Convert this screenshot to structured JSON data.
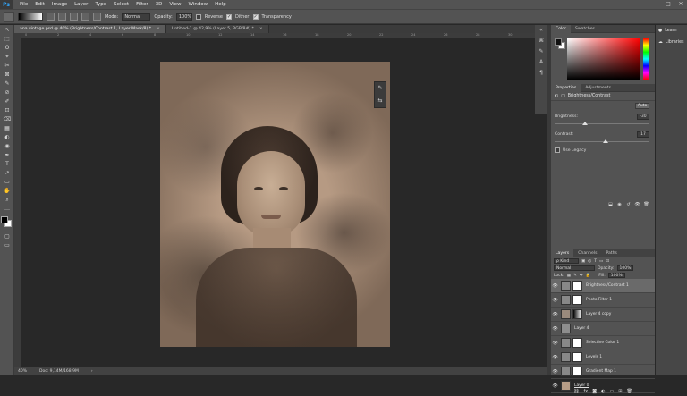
{
  "menu": [
    "File",
    "Edit",
    "Image",
    "Layer",
    "Type",
    "Select",
    "Filter",
    "3D",
    "View",
    "Window",
    "Help"
  ],
  "window_controls": [
    "—",
    "□",
    "✕"
  ],
  "app_logo": "Ps",
  "options": {
    "mode_label": "Mode:",
    "mode_value": "Normal",
    "opacity_label": "Opacity:",
    "opacity_value": "100%",
    "reverse_label": "Reverse",
    "dither_label": "Dither",
    "transparency_label": "Transparency",
    "dither_checked": "✓",
    "transparency_checked": "✓"
  },
  "tabs": [
    {
      "label": "ana vintage.psd @ 40% (Brightness/Contrast 1, Layer Mask/8) *",
      "close": "×"
    },
    {
      "label": "Untitled-1 @ 42,9% (Layer 5, RGB/8#) *",
      "close": "×"
    }
  ],
  "ruler_ticks": [
    "0",
    "2",
    "4",
    "6",
    "8",
    "10",
    "12",
    "14",
    "16",
    "18",
    "20",
    "22",
    "24",
    "26",
    "28",
    "30"
  ],
  "status": {
    "zoom": "40%",
    "doc": "Doc: 9,14M/168,9M",
    "arrow": "›"
  },
  "tools": [
    "↖",
    "⬚",
    "ʘ",
    "⌖",
    "✂",
    "⊠",
    "✎",
    "⊘",
    "✐",
    "⊡",
    "⌫",
    "▦",
    "◐",
    "◉",
    "✒",
    "T",
    "↗",
    "▭",
    "✋",
    "⌕",
    "…"
  ],
  "right_col": [
    {
      "icon": "●",
      "label": "Learn"
    },
    {
      "icon": "☁",
      "label": "Libraries"
    }
  ],
  "color_panel": {
    "tabs": [
      "Color",
      "Swatches"
    ]
  },
  "properties": {
    "tabs": [
      "Properties",
      "Adjustments"
    ],
    "title": "Brightness/Contrast",
    "auto_label": "Auto",
    "brightness_label": "Brightness:",
    "brightness_value": "-30",
    "contrast_label": "Contrast:",
    "contrast_value": "17",
    "legacy_label": "Use Legacy"
  },
  "layers_panel": {
    "tabs": [
      "Layers",
      "Channels",
      "Paths"
    ],
    "kind_label": "ρ Kind",
    "blend_mode": "Normal",
    "opacity_label": "Opacity:",
    "opacity_value": "100%",
    "lock_label": "Lock:",
    "fill_label": "Fill:",
    "fill_value": "100%",
    "layers": [
      {
        "name": "Brightness/Contrast 1",
        "eye": "👁",
        "active": true
      },
      {
        "name": "Photo Filter 1",
        "eye": "👁",
        "active": false
      },
      {
        "name": "Layer 4 copy",
        "eye": "👁",
        "active": false
      },
      {
        "name": "Layer 4",
        "eye": "👁",
        "active": false
      },
      {
        "name": "Selective Color 1",
        "eye": "👁",
        "active": false
      },
      {
        "name": "Levels 1",
        "eye": "👁",
        "active": false
      },
      {
        "name": "Gradient Map 1",
        "eye": "👁",
        "active": false
      },
      {
        "name": "Layer 0",
        "eye": "👁",
        "active": false
      }
    ]
  }
}
